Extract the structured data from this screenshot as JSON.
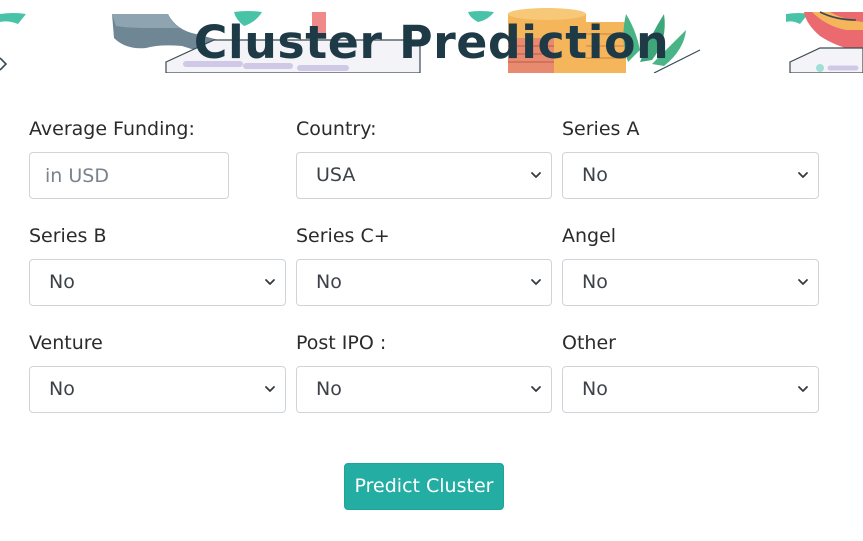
{
  "header": {
    "title": "Cluster Prediction"
  },
  "form": {
    "average_funding": {
      "label": "Average Funding:",
      "placeholder": "in USD",
      "value": ""
    },
    "country": {
      "label": "Country:",
      "value": "USA"
    },
    "series_a": {
      "label": "Series A",
      "value": "No"
    },
    "series_b": {
      "label": "Series B",
      "value": "No"
    },
    "series_c": {
      "label": "Series C+",
      "value": "No"
    },
    "angel": {
      "label": "Angel",
      "value": "No"
    },
    "venture": {
      "label": "Venture",
      "value": "No"
    },
    "post_ipo": {
      "label": "Post IPO :",
      "value": "No"
    },
    "other": {
      "label": "Other",
      "value": "No"
    }
  },
  "actions": {
    "predict_label": "Predict Cluster"
  },
  "colors": {
    "title": "#1e3a47",
    "button": "#24ada3",
    "border": "#cfd4da"
  },
  "icons": {
    "select_arrow": "chevron-down-icon",
    "banner_art": [
      "wrench-icon",
      "coin-stack-icon",
      "plant-icon",
      "pie-chart-icon"
    ]
  }
}
